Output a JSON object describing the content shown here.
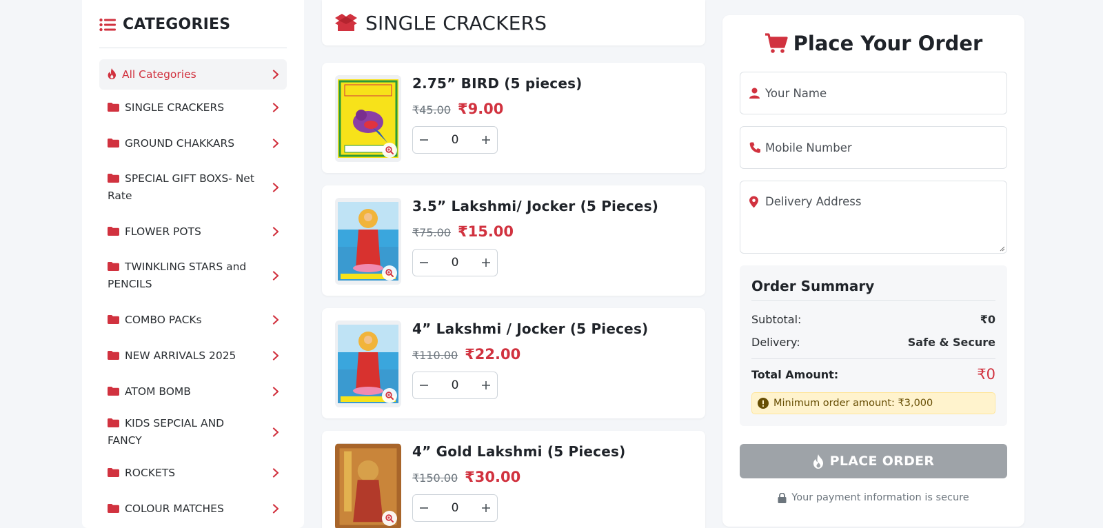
{
  "colors": {
    "accent": "#d1323f",
    "muted": "#6c757d",
    "button_disabled": "#9ea3a8",
    "warning_bg": "#fff3cd"
  },
  "sidebar": {
    "title": "CATEGORIES",
    "title_icon": "list-icon",
    "items": [
      {
        "label": "All Categories",
        "icon": "fire-icon",
        "active": true
      },
      {
        "label": "SINGLE CRACKERS",
        "icon": "folder-icon"
      },
      {
        "label": "GROUND CHAKKARS",
        "icon": "folder-icon"
      },
      {
        "label": "SPECIAL GIFT BOXS- Net Rate",
        "icon": "folder-icon"
      },
      {
        "label": "FLOWER POTS",
        "icon": "folder-icon"
      },
      {
        "label": "TWINKLING STARS and PENCILS",
        "icon": "folder-icon"
      },
      {
        "label": "COMBO PACKs",
        "icon": "folder-icon"
      },
      {
        "label": "NEW ARRIVALS 2025",
        "icon": "folder-icon"
      },
      {
        "label": "ATOM BOMB",
        "icon": "folder-icon"
      },
      {
        "label": "KIDS SEPCIAL AND FANCY",
        "icon": "folder-icon"
      },
      {
        "label": "ROCKETS",
        "icon": "folder-icon"
      },
      {
        "label": "COLOUR MATCHES",
        "icon": "folder-icon"
      }
    ]
  },
  "main": {
    "section_title": "SINGLE CRACKERS",
    "section_icon": "box-open-icon",
    "products": [
      {
        "name": "2.75” BIRD (5 pieces)",
        "old_price": "₹45.00",
        "price": "₹9.00",
        "qty": "0"
      },
      {
        "name": "3.5” Lakshmi/ Jocker (5 Pieces)",
        "old_price": "₹75.00",
        "price": "₹15.00",
        "qty": "0"
      },
      {
        "name": "4” Lakshmi / Jocker (5 Pieces)",
        "old_price": "₹110.00",
        "price": "₹22.00",
        "qty": "0"
      },
      {
        "name": "4” Gold Lakshmi (5 Pieces)",
        "old_price": "₹150.00",
        "price": "₹30.00",
        "qty": "0"
      }
    ]
  },
  "order": {
    "title": "Place Your Order",
    "title_icon": "cart-icon",
    "name_placeholder": "Your Name",
    "mobile_placeholder": "Mobile Number",
    "address_placeholder": "Delivery Address",
    "summary": {
      "title": "Order Summary",
      "subtotal_label": "Subtotal:",
      "subtotal_value": "₹0",
      "delivery_label": "Delivery:",
      "delivery_value": "Safe & Secure",
      "total_label": "Total Amount:",
      "total_value": "₹0",
      "minimum_note": "Minimum order amount: ₹3,000"
    },
    "place_order_label": "PLACE ORDER",
    "secure_note": "Your payment information is secure"
  }
}
